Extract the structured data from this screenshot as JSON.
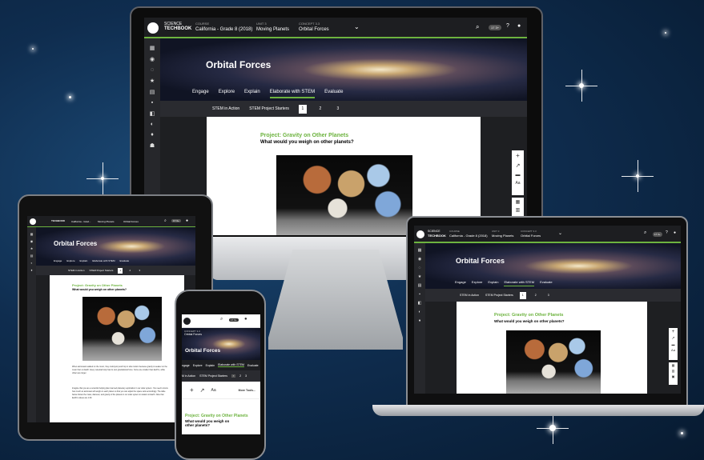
{
  "brand": {
    "line1": "SCIENCE",
    "line2": "TECHBOOK"
  },
  "course": {
    "label": "COURSE",
    "value": "California - Grade 8 (2018)"
  },
  "unit": {
    "label": "UNIT 3",
    "value": "Moving Planets"
  },
  "concept": {
    "label": "CONCEPT 3.3",
    "value": "Orbital Forces"
  },
  "page_title": "Orbital Forces",
  "tabs": [
    "Engage",
    "Explore",
    "Explain",
    "Elaborate with STEM",
    "Evaluate"
  ],
  "active_tab": "Elaborate with STEM",
  "subtabs": [
    "STEM in Action",
    "STEM Project Starters"
  ],
  "pages": [
    "1",
    "2",
    "3"
  ],
  "current_page": "1",
  "user_badge": "17 3+",
  "project": {
    "title": "Project: Gravity on Other Planets",
    "subtitle": "What would you weigh on other planets?"
  },
  "tablet": {
    "course_short": "California - Grad...",
    "para1": "When astronauts walked on the moon, they could jump and hop in slow motion because gravity is weaker on the moon than on Earth. Every celestial body has its own gravitational force. Some are smaller than Earth's, while others are larger.",
    "para2": "Imagine that you are a scientist helping plan manned planetary exploration in our solar system. You need to know how much an astronaut will weigh on each planet so that you can adjust the space suits accordingly. The table below shows the mass, diameter, and gravity of the planets in our solar system in relation to Earth. Note that Earth's values are 1.00."
  },
  "phone": {
    "tabs": [
      "ngage",
      "Explore",
      "Explain",
      "Elaborate with STEM",
      "Evaluate"
    ],
    "subtabs": [
      "M in Action",
      "STEM Project Starters"
    ],
    "text_size": "Aa",
    "more_tools": "More Tools..."
  },
  "colors": {
    "accent": "#6db33f",
    "dark": "#1e1f22",
    "sidebar": "#26272b"
  }
}
